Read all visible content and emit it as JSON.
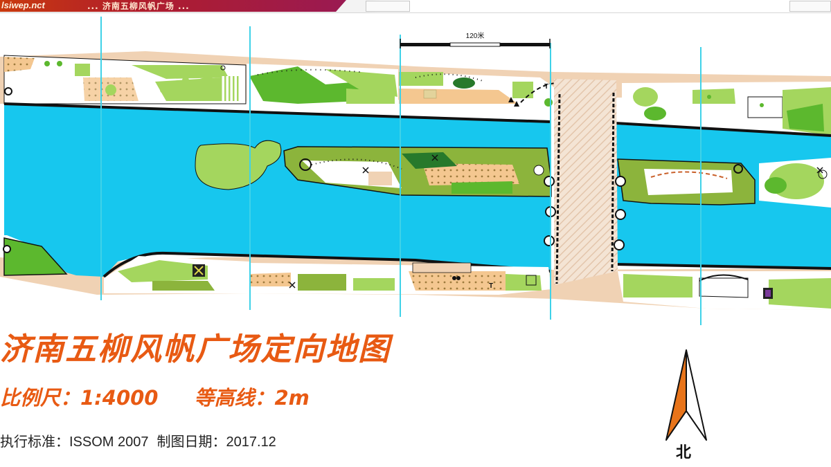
{
  "top_banner": {
    "brand": "lsiwep.nct",
    "subtitle": "... 济南五柳风帆广场 ..."
  },
  "map": {
    "scale_bar_label": "120米",
    "colors": {
      "water": "#17c7ee",
      "open_land": "#f4c790",
      "light_green": "#a4d65e",
      "green": "#5cb82e",
      "dark_green": "#27792b",
      "white_forest": "#ffffff",
      "olive_vegetation": "#8cb43c",
      "paved_area": "#f0d2b4",
      "bridge_hatch": "#f2dfcd",
      "magnetic_north_lines": "#3fd2e8",
      "bank_line": "#111111"
    },
    "symbols": [
      "tree-icon",
      "boulder-icon",
      "cross-icon",
      "bridge-icon",
      "statue-icon"
    ]
  },
  "legend": {
    "title": "济南五柳风帆广场定向地图",
    "scale_label": "比例尺：1:4000",
    "contour_label": "等高线：2m",
    "standard_label": "执行标准：ISSOM 2007",
    "date_label": "制图日期：2017.12",
    "north_label": "北"
  }
}
